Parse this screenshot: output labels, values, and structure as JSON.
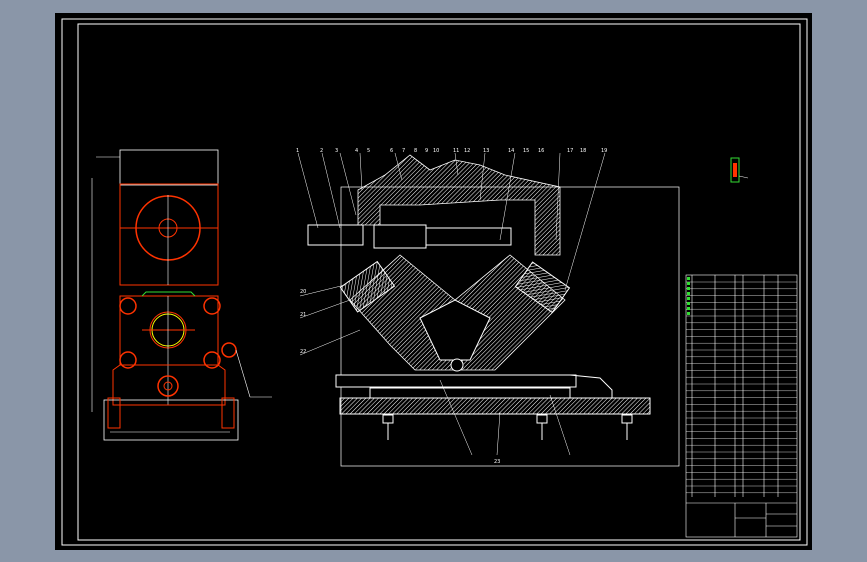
{
  "drawing": {
    "colors": {
      "background": "#000000",
      "viewport": "#8a96a8",
      "lines": "#ffffff",
      "part_lines": "#ff3300",
      "highlight": "#33dd33",
      "accent": "#ffff00"
    },
    "leader_labels_top": [
      "1",
      "2",
      "3",
      "4",
      "5",
      "6",
      "7",
      "8",
      "9",
      "10",
      "11",
      "12",
      "13",
      "14",
      "15",
      "16",
      "17",
      "18",
      "19",
      "20",
      "21",
      "22",
      "23"
    ]
  }
}
